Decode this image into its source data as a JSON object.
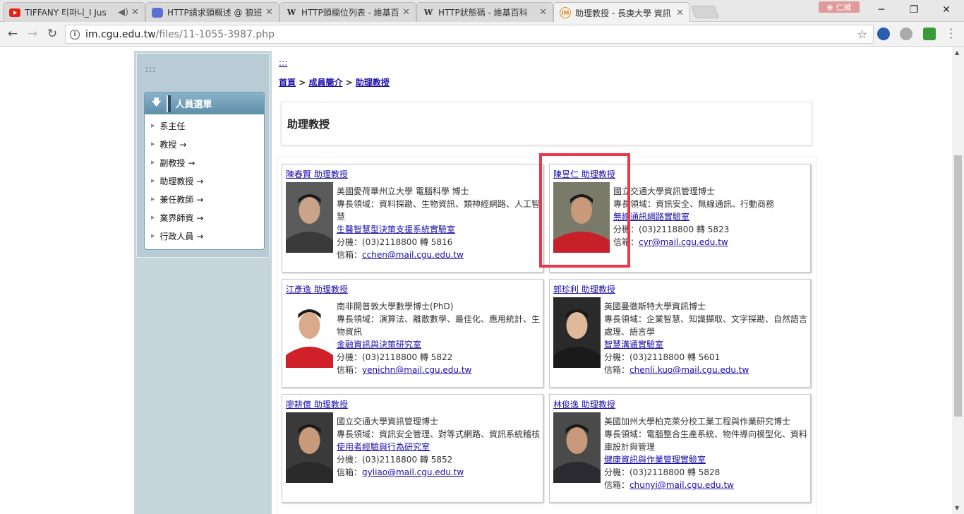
{
  "browser": {
    "tabs": [
      {
        "title": "TIFFANY 티파니_I Jus",
        "icon": "youtube-icon",
        "active": false
      },
      {
        "title": "HTTP請求頭概述 @ 狼班",
        "icon": "blogger-icon",
        "active": false
      },
      {
        "title": "HTTP頭欄位列表 - 維基百",
        "icon": "wikipedia-icon",
        "active": false
      },
      {
        "title": "HTTP狀態碼 - 維基百科",
        "icon": "wikipedia-icon",
        "active": false
      },
      {
        "title": "助理教授 - 長庚大學 資訊",
        "icon": "cgu-im-icon",
        "active": true
      }
    ],
    "profile_name": "仁維",
    "url_host": "im.cgu.edu.tw",
    "url_path": "/files/11-1055-3987.php"
  },
  "sidebar": {
    "dots": ":::",
    "menu_title": "人員選單",
    "items": [
      "系主任",
      "教授 →",
      "副教授 →",
      "助理教授 →",
      "兼任教師 →",
      "業界師資 →",
      "行政人員 →"
    ]
  },
  "main": {
    "anchor": ":::",
    "breadcrumb": {
      "home": "首頁",
      "sep": ">",
      "members": "成員簡介",
      "current": "助理教授"
    },
    "title": "助理教授"
  },
  "people": [
    {
      "name": "陳春賢 助理教授",
      "edu": "美國愛荷華州立大學 電腦科學 博士",
      "field": "專長領域：資料探勘、生物資訊、類神經網路、人工智慧",
      "lab": "生醫智慧型決策支援系統實驗室",
      "ext": "分機：(03)2118800 轉 5816",
      "email_label": "信箱：",
      "email": "cchen@mail.cgu.edu.tw",
      "colors": {
        "bg": "#5a5a5a",
        "face": "#c9a48a",
        "body": "#3a3a3a"
      }
    },
    {
      "name": "陳昱仁 助理教授",
      "edu": "國立交通大學資訊管理博士",
      "field": "專長領域：資訊安全、無線通訊、行動商務",
      "lab": "無線通訊網路實驗室",
      "ext": "分機：(03)2118800 轉 5823",
      "email_label": "信箱：",
      "email": "cyr@mail.cgu.edu.tw",
      "colors": {
        "bg": "#7a7a6a",
        "face": "#c99a7a",
        "body": "#c8202a"
      }
    },
    {
      "name": "江彥逸 助理教授",
      "edu": "南非開普敦大學數學博士(PhD)",
      "field": "專長領域：演算法、離散數學、最佳化、應用統計、生物資訊",
      "lab": "金融資訊與決策研究室",
      "ext": "分機：(03)2118800 轉 5822",
      "email_label": "信箱：",
      "email": "yenichn@mail.cgu.edu.tw",
      "colors": {
        "bg": "#ffffff",
        "face": "#d9ab8c",
        "body": "#d0202a"
      }
    },
    {
      "name": "郭珍利 助理教授",
      "edu": "英國曼徹斯特大學資訊博士",
      "field": "專長領域：企業智慧、知識擷取、文字探勘、自然語言處理、語言學",
      "lab": "智慧溝通實驗室",
      "ext": "分機：(03)2118800 轉 5601",
      "email_label": "信箱：",
      "email": "chenli.kuo@mail.cgu.edu.tw",
      "colors": {
        "bg": "#2a2a2a",
        "face": "#e0b89a",
        "body": "#1a1a1a"
      }
    },
    {
      "name": "廖耕億 助理教授",
      "edu": "國立交通大學資訊管理博士",
      "field": "專長領域：資訊安全管理、對等式網路、資訊系統稽核",
      "lab": "使用者經驗與行為研究室",
      "ext": "分機：(03)2118800 轉 5852",
      "email_label": "信箱：",
      "email": "gyliao@mail.cgu.edu.tw",
      "colors": {
        "bg": "#3a3a3a",
        "face": "#c99a7a",
        "body": "#2a2a2a"
      }
    },
    {
      "name": "林俊逸 助理教授",
      "edu": "美國加州大學柏克萊分校工業工程與作業研究博士",
      "field": "專長領域：電腦整合生產系統、物件導向模型化、資料庫設計與管理",
      "lab": "健康資訊與作業管理實驗室",
      "ext": "分機：(03)2118800 轉 5828",
      "email_label": "信箱：",
      "email": "chunyi@mail.cgu.edu.tw",
      "colors": {
        "bg": "#4a4a4a",
        "face": "#c8987a",
        "body": "#2a2a30"
      }
    }
  ],
  "colors": {
    "accent_red": "#e8394a",
    "link": "#1a0dab",
    "menu_header": "#6f9bb3"
  }
}
